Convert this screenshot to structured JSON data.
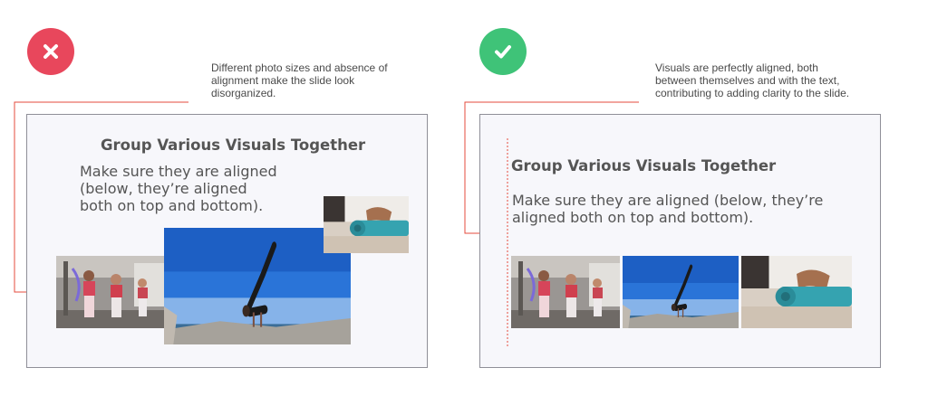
{
  "colors": {
    "bad": "#e8475c",
    "good": "#3fc378",
    "connector": "#e44b3c",
    "slide_bg": "#f7f7fb",
    "text": "#555555"
  },
  "bad_example": {
    "icon": "x-mark-icon",
    "note_lines": [
      "Different photo sizes and absence of",
      "alignment make the slide look",
      "disorganized."
    ],
    "slide": {
      "title": "Group Various Visuals Together",
      "body_lines": [
        "Make sure they are aligned",
        "(below, they’re aligned",
        "both on top and bottom)."
      ]
    }
  },
  "good_example": {
    "icon": "checkmark-icon",
    "note_lines": [
      "Visuals are perfectly aligned, both",
      "between themselves and with the text,",
      "contributing to adding clarity to the slide."
    ],
    "slide": {
      "title": "Group Various Visuals Together",
      "body_lines": [
        "Make sure they are aligned (below, they’re",
        "aligned both on top and bottom)."
      ]
    }
  }
}
